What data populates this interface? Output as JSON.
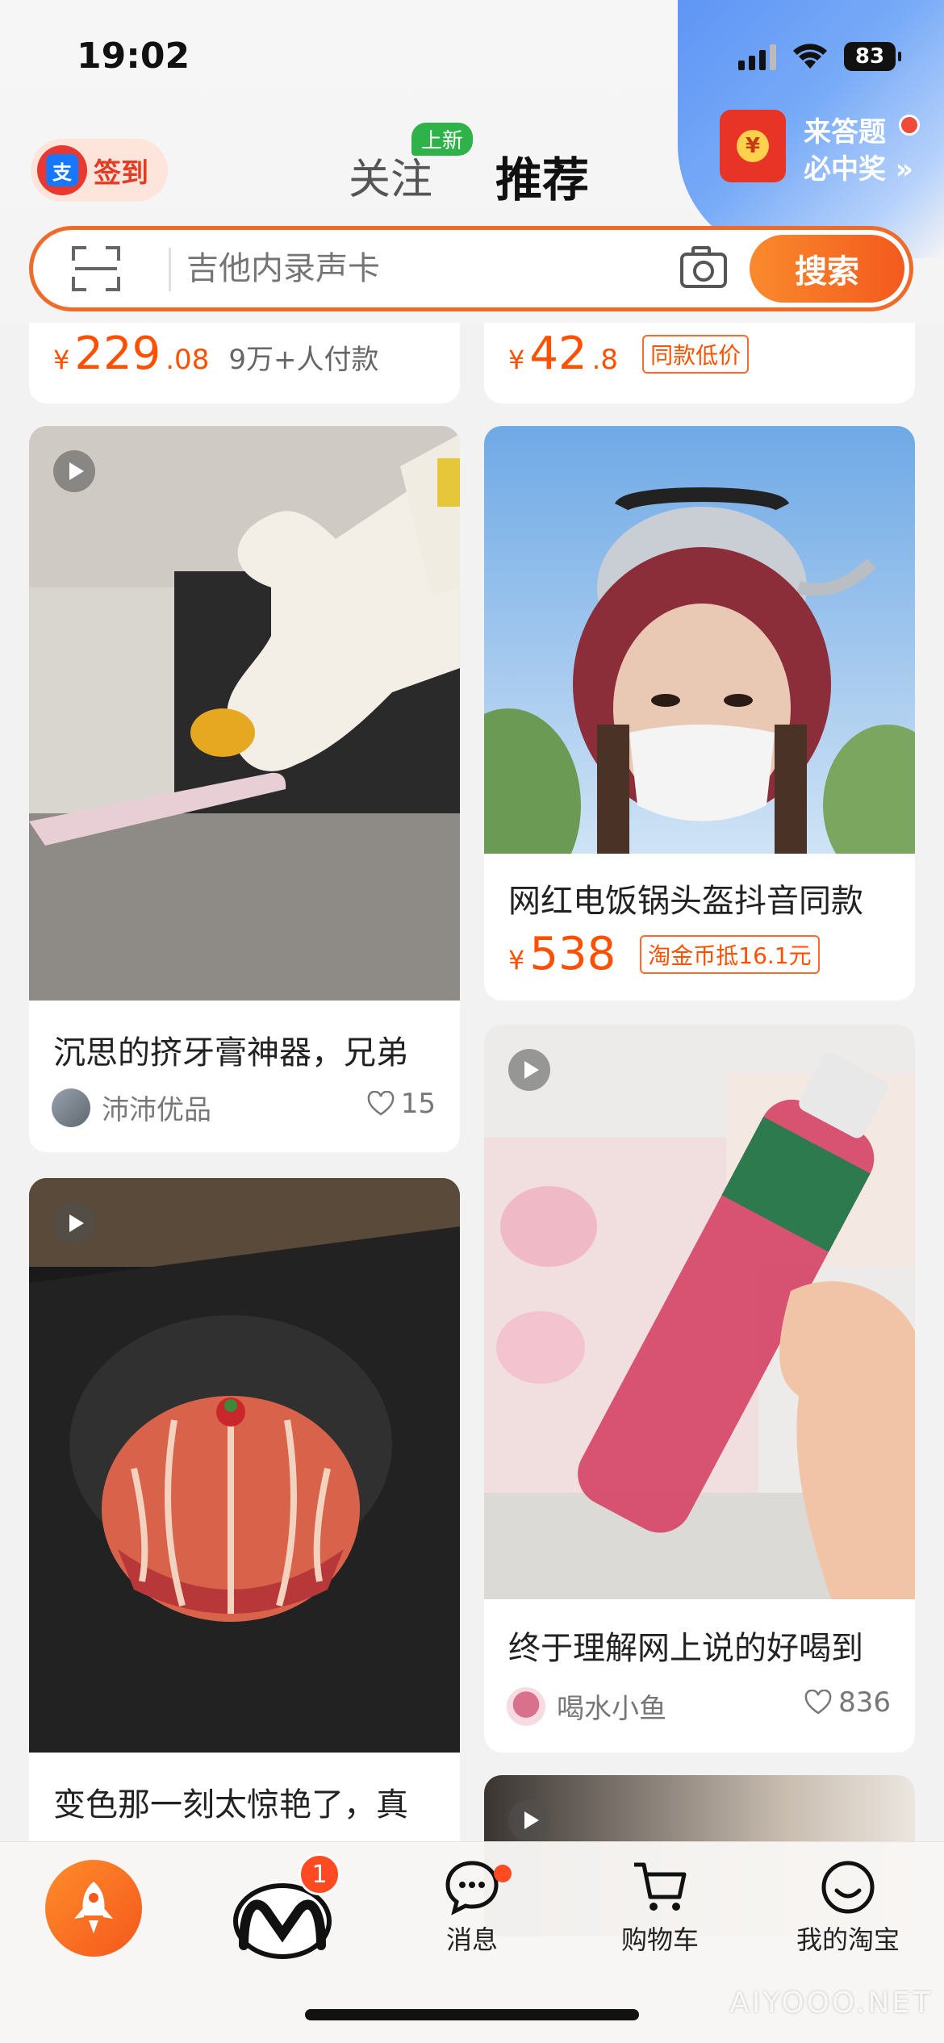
{
  "status_bar": {
    "time": "19:02",
    "battery": "83"
  },
  "header": {
    "signin_label": "签到",
    "signin_logo_glyph": "支",
    "tabs": [
      {
        "label": "关注",
        "badge": "上新"
      },
      {
        "label": "推荐"
      }
    ],
    "promo": {
      "line1": "来答题",
      "line2": "必中奖 »",
      "coin": "¥"
    }
  },
  "search": {
    "placeholder": "吉他内录声卡",
    "button": "搜索"
  },
  "feed": {
    "top_left": {
      "yen": "¥",
      "price_int": "229",
      "price_dec": ".08",
      "sub": "9万+人付款"
    },
    "top_right": {
      "yen": "¥",
      "price_int": "42",
      "price_dec": ".8",
      "tag": "同款低价"
    },
    "card_toothpaste": {
      "title": "沉思的挤牙膏神器，兄弟",
      "author": "沛沛优品",
      "likes": "15"
    },
    "card_helmet": {
      "title": "网红电饭锅头盔抖音同款",
      "yen": "¥",
      "price": "538",
      "tag": "淘金币抵16.1元"
    },
    "card_drink": {
      "title": "终于理解网上说的好喝到",
      "author": "喝水小鱼",
      "likes": "836"
    },
    "card_orange": {
      "title": "变色那一刻太惊艳了，真"
    }
  },
  "bottom_nav": {
    "badge": "1",
    "items": [
      {
        "label": "消息"
      },
      {
        "label": "购物车"
      },
      {
        "label": "我的淘宝"
      }
    ]
  },
  "watermark": "AIYOOO.NET",
  "colors": {
    "accent": "#ff5000",
    "search_border": "#f06a2a",
    "promo_blue": "#6b9ff6"
  }
}
